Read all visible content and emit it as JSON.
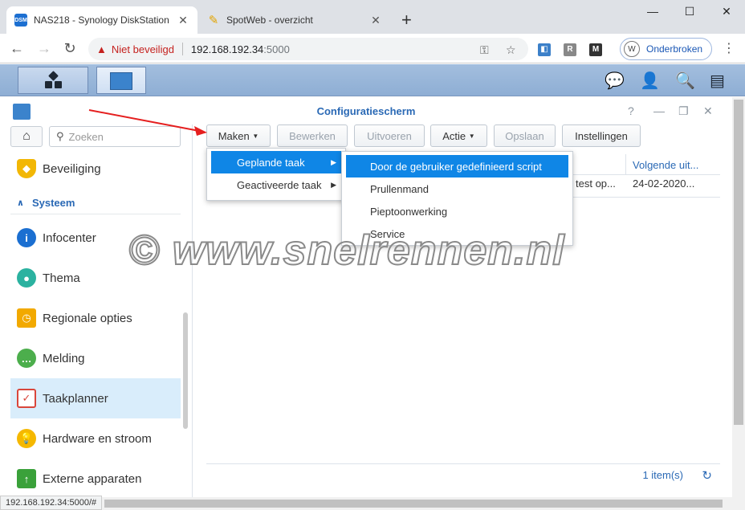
{
  "browser": {
    "tabs": [
      {
        "title": "NAS218 - Synology DiskStation",
        "favicon": "DSM"
      },
      {
        "title": "SpotWeb - overzicht"
      }
    ],
    "new_tab": "+",
    "security_label": "Niet beveiligd",
    "url_host": "192.168.192.34",
    "url_port": ":5000",
    "profile_initial": "W",
    "profile_label": "Onderbroken",
    "extension_r": "R",
    "extension_m": "M",
    "status_url": "192.168.192.34:5000/#"
  },
  "window": {
    "title": "Configuratiescherm"
  },
  "sidebar": {
    "search_placeholder": "Zoeken",
    "section": "Systeem",
    "items": [
      {
        "label": "Beveiliging",
        "color": "#f2b705"
      },
      {
        "label": "Infocenter",
        "color": "#1b6fd1"
      },
      {
        "label": "Thema",
        "color": "#2bb2a0"
      },
      {
        "label": "Regionale opties",
        "color": "#f2a900"
      },
      {
        "label": "Melding",
        "color": "#4cae4c"
      },
      {
        "label": "Taakplanner",
        "color": "#d9463b"
      },
      {
        "label": "Hardware en stroom",
        "color": "#f5b800"
      },
      {
        "label": "Externe apparaten",
        "color": "#3aa13a"
      }
    ]
  },
  "toolbar": {
    "create": "Maken",
    "edit": "Bewerken",
    "run": "Uitvoeren",
    "action": "Actie",
    "save": "Opslaan",
    "settings": "Instellingen"
  },
  "grid": {
    "column_next": "Volgende uit...",
    "row_desc": "test op...",
    "row_next": "24-02-2020..."
  },
  "menu": {
    "scheduled_task": "Geplande taak",
    "triggered_task": "Geactiveerde taak",
    "submenu": [
      "Door de gebruiker gedefinieerd script",
      "Prullenmand",
      "Pieptoonwerking",
      "Service"
    ]
  },
  "footer": {
    "count": "1 item(s)"
  },
  "watermark": "© www.snelrennen.nl",
  "accent_color": "#0f86e6"
}
